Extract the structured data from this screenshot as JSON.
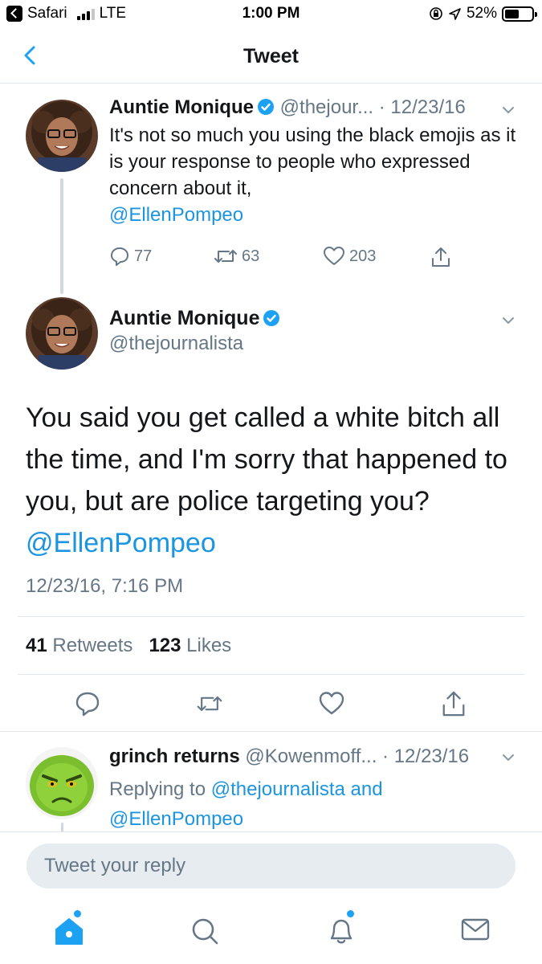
{
  "status_bar": {
    "back_app": "Safari",
    "network": "LTE",
    "time": "1:00 PM",
    "battery": "52%",
    "battery_level": 0.52
  },
  "nav": {
    "title": "Tweet"
  },
  "tweet1": {
    "author": "Auntie Monique",
    "handle": "@thejour...",
    "date": "· 12/23/16",
    "text": "It's not so much you using the black emojis as it is your response to people who expressed concern about it,",
    "mention": "@EllenPompeo",
    "replies": "77",
    "retweets": "63",
    "likes": "203"
  },
  "tweet2": {
    "author": "Auntie Monique",
    "handle": "@thejournalista",
    "text": "You said you get called a white bitch all the time, and I'm sorry that happened to you, but are police targeting you?",
    "mention": "@EllenPompeo",
    "timestamp": "12/23/16, 7:16 PM",
    "retweet_count": "41",
    "retweet_label": "Retweets",
    "like_count": "123",
    "like_label": "Likes"
  },
  "tweet3": {
    "author": "grinch returns",
    "handle": "@Kowenmoff...",
    "date": "· 12/23/16",
    "replying_prefix": "Replying to",
    "replying_to_1": "@thejournalista",
    "replying_and": "and",
    "replying_to_2": "@EllenPompeo"
  },
  "reply_box": {
    "placeholder": "Tweet your reply"
  },
  "colors": {
    "accent": "#1da1f2",
    "link": "#1b95e0",
    "muted": "#657786"
  },
  "icons": [
    "back-chevron-icon",
    "verified-badge-icon",
    "caret-down-icon",
    "reply-icon",
    "retweet-icon",
    "like-icon",
    "share-icon",
    "home-icon",
    "search-icon",
    "notifications-icon",
    "messages-icon"
  ]
}
